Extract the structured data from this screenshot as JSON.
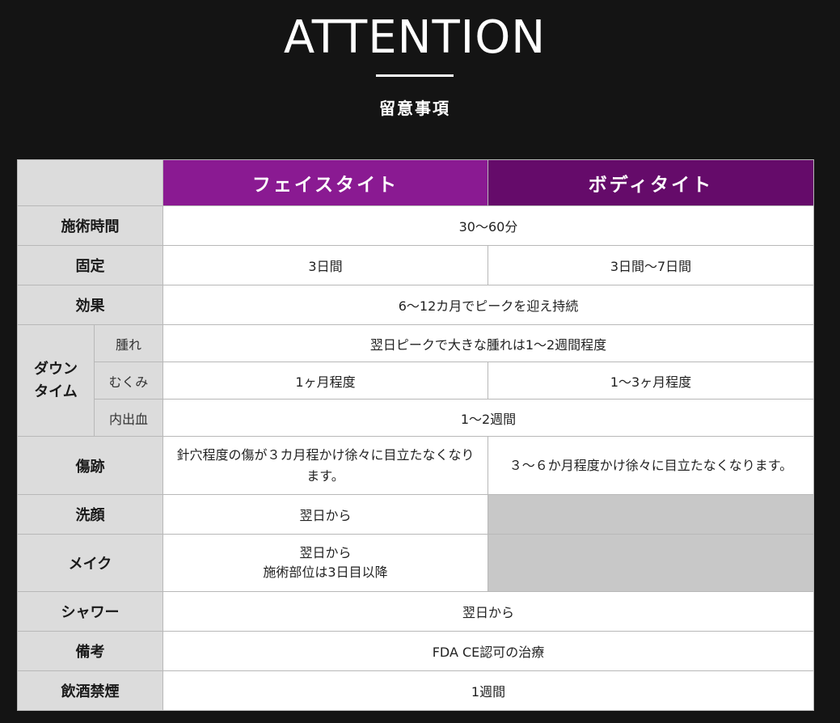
{
  "header": {
    "title": "ATTENTION",
    "subtitle": "留意事項"
  },
  "table": {
    "columns": {
      "face": "フェイスタイト",
      "body": "ボディタイト"
    },
    "rows": {
      "treatment_time": {
        "label": "施術時間",
        "value": "30〜60分"
      },
      "fixation": {
        "label": "固定",
        "face": "3日間",
        "body": "3日間〜7日間"
      },
      "effect": {
        "label": "効果",
        "value": "6〜12カ月でピークを迎え持続"
      },
      "downtime": {
        "label_line1": "ダウン",
        "label_line2": "タイム",
        "swelling": {
          "label": "腫れ",
          "value": "翌日ピークで大きな腫れは1〜2週間程度"
        },
        "puffiness": {
          "label": "むくみ",
          "face": "1ヶ月程度",
          "body": "1〜3ヶ月程度"
        },
        "bruising": {
          "label": "内出血",
          "value": "1〜2週間"
        }
      },
      "scars": {
        "label": "傷跡",
        "face": "針穴程度の傷が３カ月程かけ徐々に目立たなくなります。",
        "body": "３〜６か月程度かけ徐々に目立たなくなります。"
      },
      "face_wash": {
        "label": "洗顔",
        "face": "翌日から"
      },
      "makeup": {
        "label": "メイク",
        "face_line1": "翌日から",
        "face_line2": "施術部位は3日目以降"
      },
      "shower": {
        "label": "シャワー",
        "value": "翌日から"
      },
      "notes": {
        "label": "備考",
        "value": "FDA CE認可の治療"
      },
      "drinking_smoking": {
        "label": "飲酒禁煙",
        "value": "1週間"
      }
    }
  },
  "colors": {
    "background": "#141414",
    "face_header": "#8a1a92",
    "body_header": "#650b6a",
    "label_cell": "#dcdcdc",
    "empty_cell": "#c8c8c8"
  }
}
